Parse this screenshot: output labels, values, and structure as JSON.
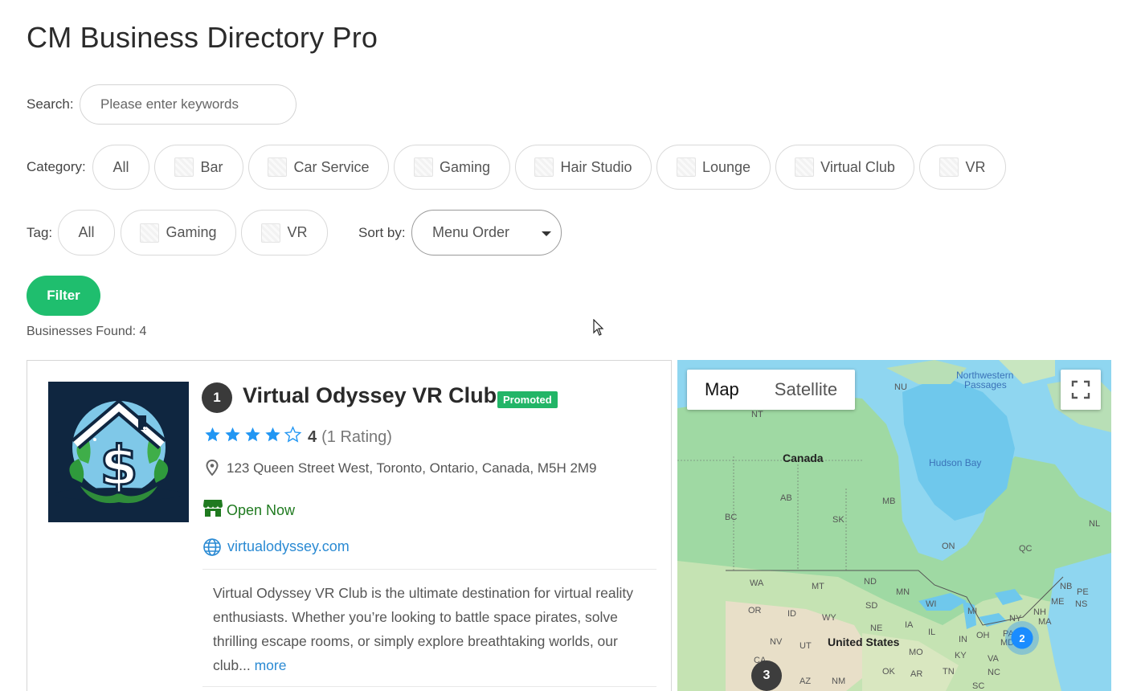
{
  "page": {
    "title": "CM Business Directory Pro"
  },
  "search": {
    "label": "Search:",
    "placeholder": "Please enter keywords"
  },
  "category": {
    "label": "Category:",
    "items": [
      "All",
      "Bar",
      "Car Service",
      "Gaming",
      "Hair Studio",
      "Lounge",
      "Virtual Club",
      "VR"
    ]
  },
  "tag": {
    "label": "Tag:",
    "items": [
      "All",
      "Gaming",
      "VR"
    ]
  },
  "sort": {
    "label": "Sort by:",
    "selected": "Menu Order"
  },
  "filter": {
    "label": "Filter"
  },
  "results": {
    "found": "Businesses Found: 4"
  },
  "listing": {
    "rank": "1",
    "name": "Virtual Odyssey VR Club",
    "badge": "Promoted",
    "rating_value": "4",
    "rating_count": "(1 Rating)",
    "stars_filled": 4,
    "stars_total": 5,
    "address": "123 Queen Street West, Toronto, Ontario, Canada, M5H 2M9",
    "status": "Open Now",
    "website": "virtualodyssey.com",
    "description": "Virtual Odyssey VR Club is the ultimate destination for virtual reality enthusiasts. Whether you’re looking to battle space pirates, solve thrilling escape rooms, or simply explore breathtaking worlds, our club...",
    "more": "more"
  },
  "map": {
    "type_map": "Map",
    "type_satellite": "Satellite",
    "labels": {
      "canada": "Canada",
      "us": "United States",
      "hudson": "Hudson Bay",
      "northwestern": "Northwestern",
      "passages": "Passages",
      "nu": "NU",
      "nt": "NT",
      "ab": "AB",
      "bc": "BC",
      "mb": "MB",
      "sk": "SK",
      "on": "ON",
      "qc": "QC",
      "nl": "NL",
      "nb": "NB",
      "pe": "PE",
      "ns": "NS",
      "wa": "WA",
      "mt": "MT",
      "nd": "ND",
      "mn": "MN",
      "sd": "SD",
      "or": "OR",
      "id": "ID",
      "wy": "WY",
      "wi": "WI",
      "mi": "MI",
      "ne": "NE",
      "ia": "IA",
      "nv": "NV",
      "ut": "UT",
      "il": "IL",
      "in": "IN",
      "oh": "OH",
      "pa": "PA",
      "ny": "NY",
      "nh": "NH",
      "me": "ME",
      "ma": "MA",
      "md": "MD",
      "mo": "MO",
      "ky": "KY",
      "va": "VA",
      "ok": "OK",
      "ar": "AR",
      "tn": "TN",
      "nc": "NC",
      "sc": "SC",
      "nm": "NM",
      "az": "AZ",
      "ca": "CA"
    },
    "cluster_east": "2",
    "cluster_west": "3"
  },
  "colors": {
    "accent_green": "#1fbe6e",
    "link_blue": "#2a8ad3",
    "star_blue": "#2196f3"
  }
}
